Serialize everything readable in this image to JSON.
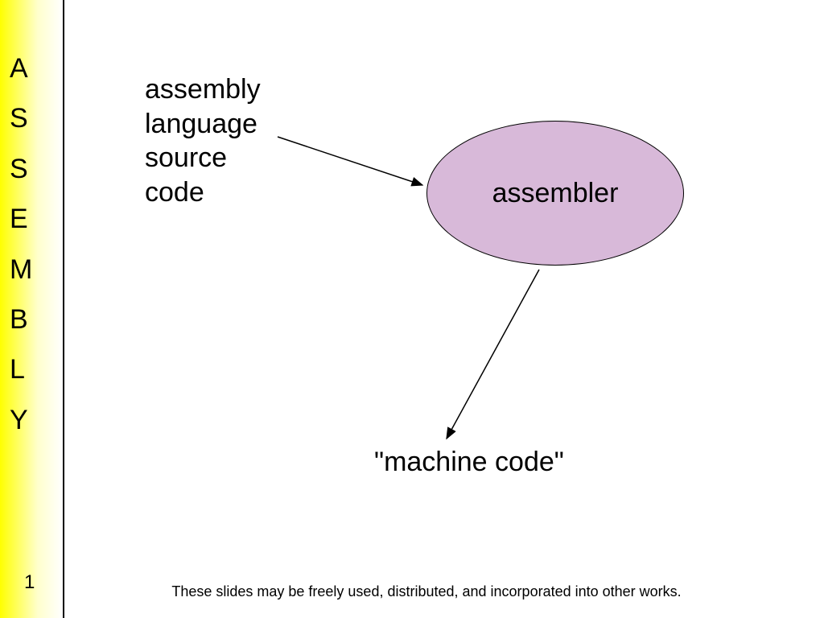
{
  "sidebar": {
    "letters": [
      "A",
      "S",
      "S",
      "E",
      "M",
      "B",
      "L",
      "Y"
    ]
  },
  "diagram": {
    "source_label": "assembly\nlanguage\nsource\ncode",
    "node_label": "assembler",
    "output_label": "\"machine code\""
  },
  "footer": {
    "slide_number": "1",
    "note": "These slides may be freely used, distributed, and incorporated into other works."
  }
}
